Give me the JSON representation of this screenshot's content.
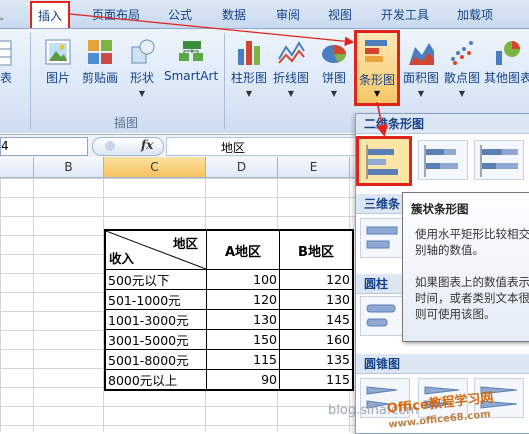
{
  "ribbon": {
    "tabs": [
      {
        "label": "插入",
        "active": true
      },
      {
        "label": "页面布局"
      },
      {
        "label": "公式"
      },
      {
        "label": "数据"
      },
      {
        "label": "审阅"
      },
      {
        "label": "视图"
      },
      {
        "label": "开发工具"
      },
      {
        "label": "加载项"
      }
    ],
    "left_cut_label": "表",
    "illustrations": {
      "buttons": [
        "图片",
        "剪贴画",
        "形状",
        "SmartArt"
      ],
      "group_label": "插图"
    },
    "charts": {
      "buttons": [
        "柱形图",
        "折线图",
        "饼图",
        "条形图",
        "面积图",
        "散点图",
        "其他图表"
      ]
    }
  },
  "formula_bar": {
    "name_box": "4",
    "fx_label": "fx",
    "value": "地区"
  },
  "sheet": {
    "columns": [
      "B",
      "C",
      "D",
      "E"
    ],
    "table": {
      "corner_top": "地区",
      "corner_bottom": "收入",
      "col_headers": [
        "A地区",
        "B地区"
      ],
      "rows": [
        {
          "label": "500元以下",
          "a": "100",
          "b": "120"
        },
        {
          "label": "501-1000元",
          "a": "120",
          "b": "130"
        },
        {
          "label": "1001-3000元",
          "a": "130",
          "b": "145"
        },
        {
          "label": "3001-5000元",
          "a": "150",
          "b": "160"
        },
        {
          "label": "5001-8000元",
          "a": "115",
          "b": "135"
        },
        {
          "label": "8000元以上",
          "a": "90",
          "b": "115"
        }
      ]
    }
  },
  "gallery": {
    "sections": [
      "二维条形图",
      "三维条",
      "圆柱",
      "圆锥图"
    ],
    "tooltip": {
      "title": "簇状条形图",
      "p1": "使用水平矩形比较相交",
      "p2": "别轴的数值。",
      "p3": "如果图表上的数值表示",
      "p4": "时间，或者类别文本很",
      "p5": "则可使用该图。"
    }
  },
  "watermark": {
    "url_text": "blog.sina.com",
    "logo_text": "Office教程学习网",
    "logo_url": "www.office68.com"
  },
  "colors": {
    "highlight": "#e0231b",
    "ribbon_text": "#15428b"
  }
}
